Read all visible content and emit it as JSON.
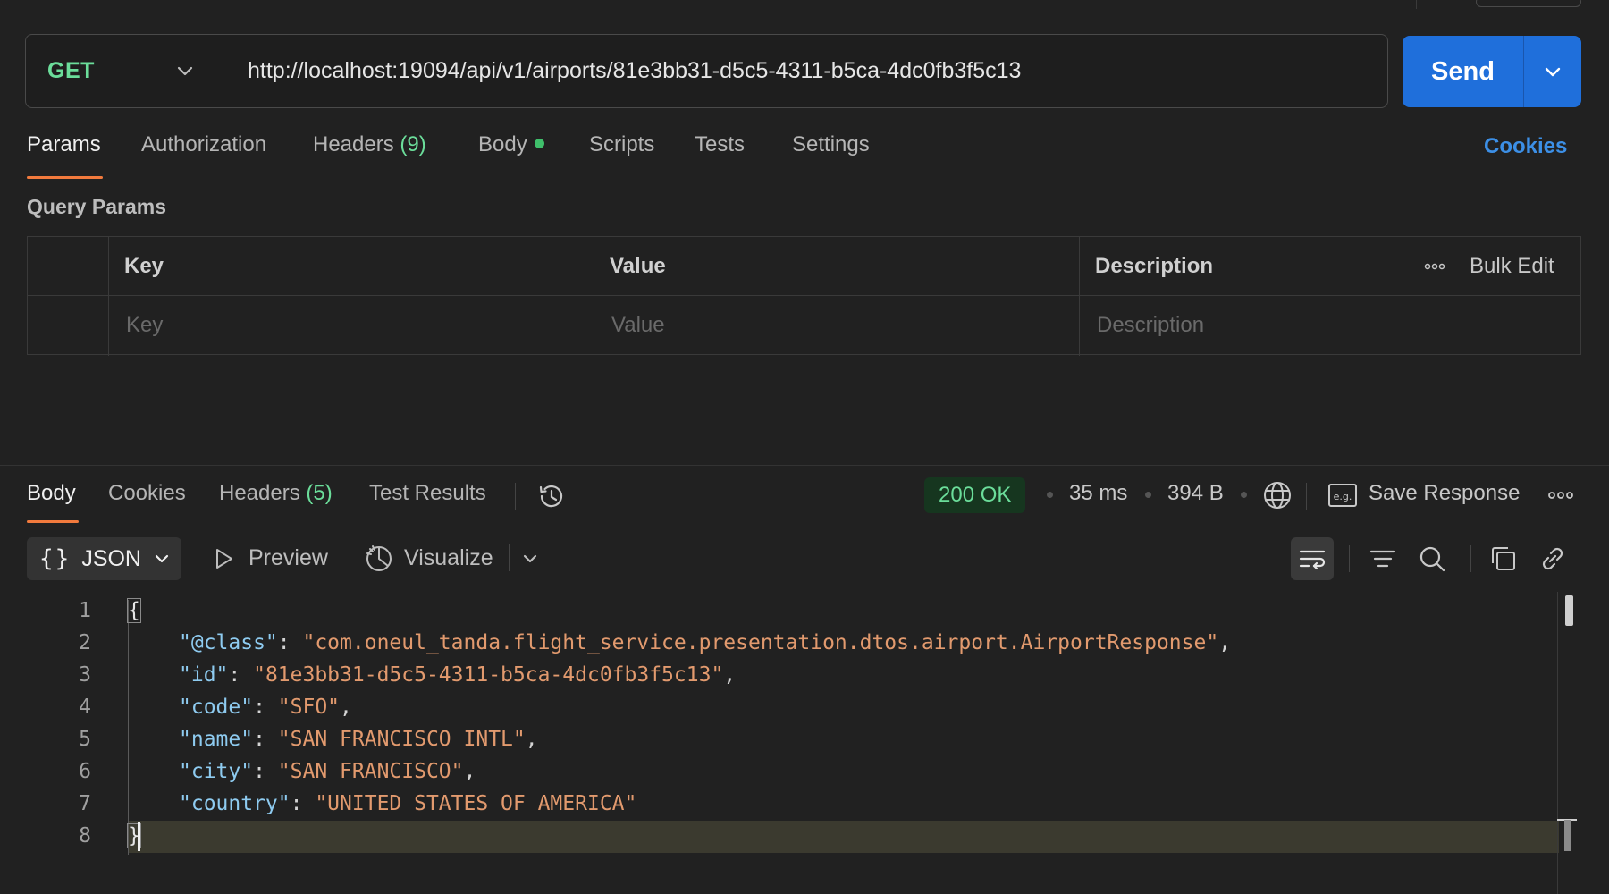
{
  "request": {
    "method": "GET",
    "url": "http://localhost:19094/api/v1/airports/81e3bb31-d5c5-4311-b5ca-4dc0fb3f5c13",
    "send_label": "Send"
  },
  "request_tabs": {
    "params": "Params",
    "authorization": "Authorization",
    "headers": "Headers",
    "headers_count": "(9)",
    "body": "Body",
    "scripts": "Scripts",
    "tests": "Tests",
    "settings": "Settings",
    "cookies": "Cookies"
  },
  "query_params": {
    "title": "Query Params",
    "col_key": "Key",
    "col_value": "Value",
    "col_description": "Description",
    "bulk_edit": "Bulk Edit",
    "placeholder_key": "Key",
    "placeholder_value": "Value",
    "placeholder_description": "Description"
  },
  "response": {
    "tabs": {
      "body": "Body",
      "cookies": "Cookies",
      "headers": "Headers",
      "headers_count": "(5)",
      "test_results": "Test Results"
    },
    "status": "200 OK",
    "time": "35 ms",
    "size": "394 B",
    "save_response": "Save Response",
    "format": "JSON",
    "preview": "Preview",
    "visualize": "Visualize"
  },
  "code": {
    "line_numbers": [
      "1",
      "2",
      "3",
      "4",
      "5",
      "6",
      "7",
      "8"
    ],
    "open_brace": "{",
    "close_brace": "}",
    "lines": [
      {
        "key": "\"@class\"",
        "value": "\"com.oneul_tanda.flight_service.presentation.dtos.airport.AirportResponse\"",
        "comma": ","
      },
      {
        "key": "\"id\"",
        "value": "\"81e3bb31-d5c5-4311-b5ca-4dc0fb3f5c13\"",
        "comma": ","
      },
      {
        "key": "\"code\"",
        "value": "\"SFO\"",
        "comma": ","
      },
      {
        "key": "\"name\"",
        "value": "\"SAN FRANCISCO INTL\"",
        "comma": ","
      },
      {
        "key": "\"city\"",
        "value": "\"SAN FRANCISCO\"",
        "comma": ","
      },
      {
        "key": "\"country\"",
        "value": "\"UNITED STATES OF AMERICA\"",
        "comma": ""
      }
    ]
  },
  "colors": {
    "accent_blue": "#1f6fdb",
    "method_green": "#6bdd9a",
    "active_tab_underline": "#f27a3d",
    "json_key": "#8ecbf0",
    "json_string": "#e29a6e"
  }
}
